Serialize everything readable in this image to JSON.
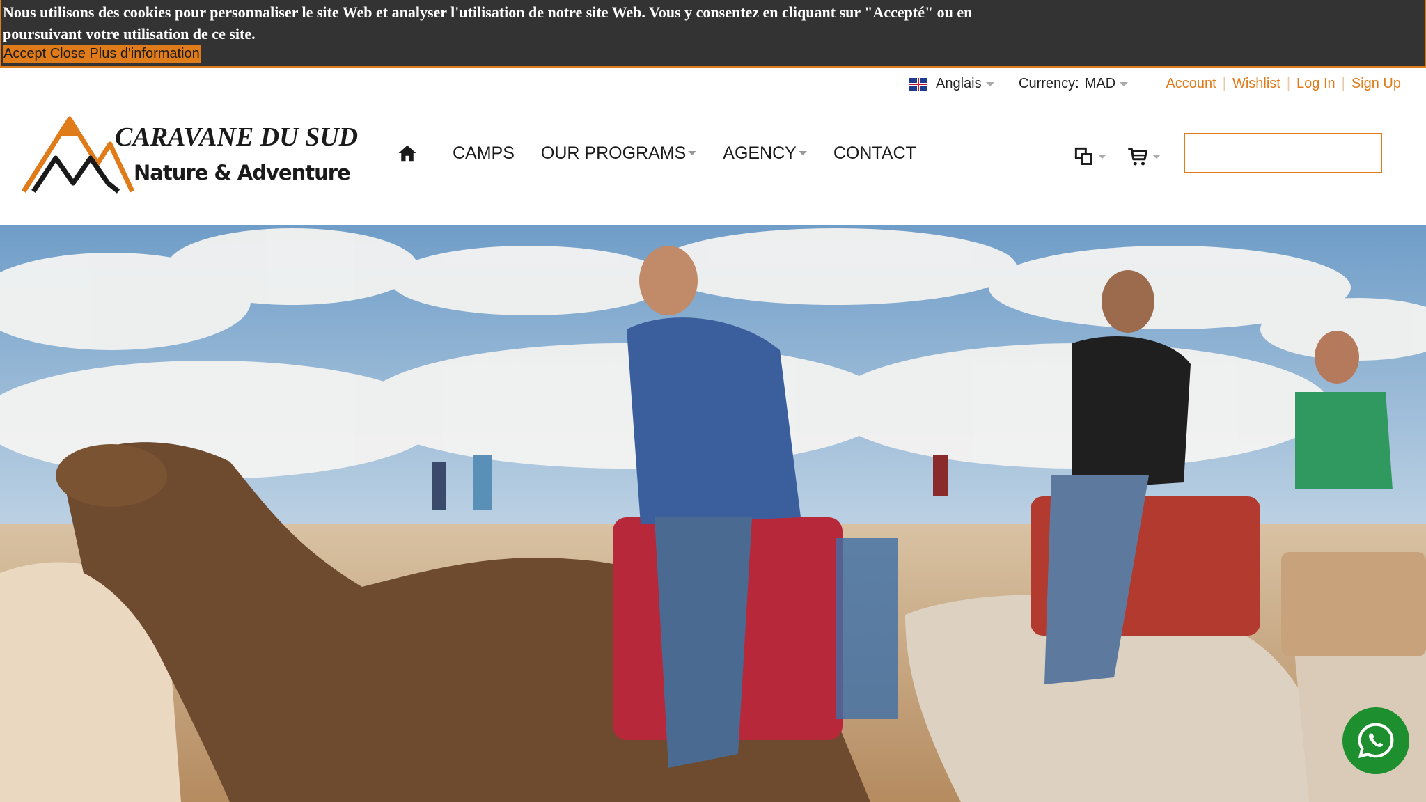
{
  "cookie_bar": {
    "message": "Nous utilisons des cookies pour personnaliser le site Web et analyser l'utilisation de notre site Web. Vous y consentez en cliquant sur \"Accepté\" ou en poursuivant votre utilisation de ce site.",
    "accept_label": "Accept",
    "close_label": "Close",
    "more_info_label": "Plus d'information"
  },
  "utility_bar": {
    "language": "Anglais",
    "currency_label": "Currency:",
    "currency_value": "MAD",
    "links": [
      "Account",
      "Wishlist",
      "Log In",
      "Sign Up"
    ]
  },
  "logo": {
    "line1": "CARAVANE DU SUD",
    "line2": "Nature & Adventure"
  },
  "nav": {
    "items": [
      {
        "label": "CAMPS",
        "has_dropdown": false
      },
      {
        "label": "OUR PROGRAMS",
        "has_dropdown": true
      },
      {
        "label": "AGENCY",
        "has_dropdown": true
      },
      {
        "label": "CONTACT",
        "has_dropdown": false
      }
    ]
  },
  "header_icons": [
    "compare-icon",
    "cart-icon"
  ],
  "search": {
    "value": "",
    "placeholder": ""
  },
  "hero": {
    "image": "tourists-riding-camels-desert"
  },
  "colors": {
    "accent": "#e07b1a",
    "cookie_bg": "#333333",
    "whatsapp": "#1d8f2e"
  }
}
